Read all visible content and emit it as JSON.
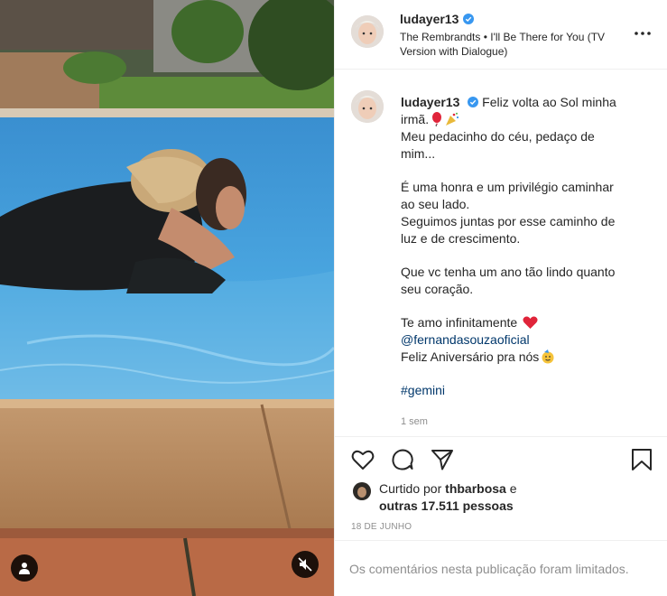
{
  "post": {
    "username": "ludayer13",
    "audio": "The Rembrandts • I'll Be There for You (TV Version with Dialogue)",
    "more_icon": "more-options-icon",
    "verified_color": "#3897f0"
  },
  "caption": {
    "username": "ludayer13",
    "lines": [
      "Feliz volta ao Sol minha",
      "irmã.",
      "Meu pedacinho do céu, pedaço de",
      "mim...",
      "É uma honra e um privilégio caminhar",
      "ao seu lado.",
      "Seguimos juntas por esse caminho de",
      "luz e de crescimento.",
      "Que vc tenha um ano tão lindo quanto",
      "seu coração.",
      "Te amo infinitamente",
      "@fernandasouzaoficial",
      "Feliz Aniversário pra nós",
      "#gemini"
    ],
    "emojis": [
      "balloon",
      "party-popper",
      "red-heart",
      "partying-face"
    ],
    "time_ago": "1 sem"
  },
  "actions": {
    "like_icon": "heart-icon",
    "comment_icon": "comment-icon",
    "share_icon": "share-icon",
    "save_icon": "bookmark-icon"
  },
  "likes": {
    "prefix": "Curtido por",
    "user": "thbarbosa",
    "and": "e",
    "others": "outras 17.511 pessoas"
  },
  "date": "18 DE JUNHO",
  "comments_limited": "Os comentários nesta publicação foram limitados.",
  "media": {
    "user_tag_icon": "user-tag-icon",
    "mute_icon": "speaker-muted-icon"
  }
}
